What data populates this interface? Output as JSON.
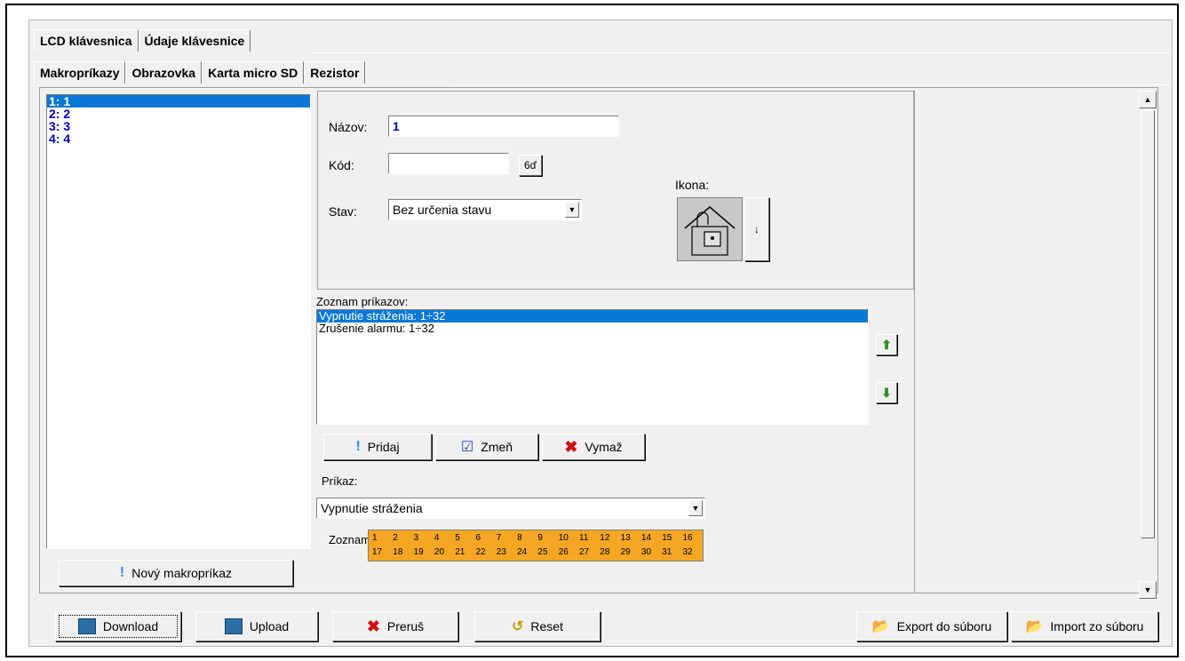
{
  "tabs_top": [
    "LCD klávesnica",
    "Údaje klávesnice"
  ],
  "tabs_sub": [
    "Makropríkazy",
    "Obrazovka",
    "Karta micro SD",
    "Rezistor"
  ],
  "macros": [
    "1: 1",
    "2: 2",
    "3: 3",
    "4: 4"
  ],
  "new_macro_label": "Nový makropríkaz",
  "form": {
    "name_label": "Názov:",
    "name_value": "1",
    "code_label": "Kód:",
    "code_value": "",
    "code_button": "6ď",
    "state_label": "Stav:",
    "state_value": "Bez určenia stavu",
    "icon_label": "Ikona:",
    "icon_arrow": "↓"
  },
  "commands": {
    "label": "Zoznam príkazov:",
    "items": [
      "Vypnutie stráženia: 1÷32",
      "Zrušenie alarmu: 1÷32"
    ],
    "up_icon": "arrow-up",
    "down_icon": "arrow-down"
  },
  "actions": {
    "add": "Pridaj",
    "change": "Zmeň",
    "delete": "Vymaž"
  },
  "command": {
    "label": "Príkaz:",
    "value": "Vypnutie stráženia",
    "list_label": "Zoznam",
    "partitions_row1": [
      "1",
      "2",
      "3",
      "4",
      "5",
      "6",
      "7",
      "8",
      "9",
      "10",
      "11",
      "12",
      "13",
      "14",
      "15",
      "16"
    ],
    "partitions_row2": [
      "17",
      "18",
      "19",
      "20",
      "21",
      "22",
      "23",
      "24",
      "25",
      "26",
      "27",
      "28",
      "29",
      "30",
      "31",
      "32"
    ]
  },
  "bottom": {
    "download": "Download",
    "upload": "Upload",
    "abort": "Preruš",
    "reset": "Reset",
    "export": "Export do súboru",
    "import": "Import zo súboru"
  },
  "colors": {
    "selection": "#0a78d7",
    "partition_bg": "#f5a623",
    "macro_text": "#0000c8"
  }
}
